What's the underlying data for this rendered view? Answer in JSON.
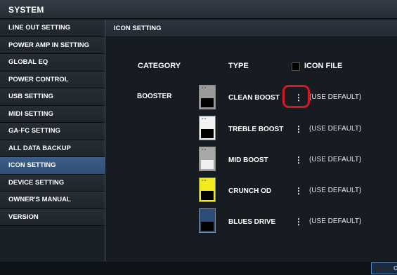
{
  "window": {
    "title": "SYSTEM"
  },
  "sidebar": {
    "items": [
      {
        "label": "LINE OUT SETTING",
        "active": false
      },
      {
        "label": "POWER AMP IN SETTING",
        "active": false
      },
      {
        "label": "GLOBAL EQ",
        "active": false
      },
      {
        "label": "POWER CONTROL",
        "active": false
      },
      {
        "label": "USB SETTING",
        "active": false
      },
      {
        "label": "MIDI SETTING",
        "active": false
      },
      {
        "label": "GA-FC SETTING",
        "active": false
      },
      {
        "label": "ALL DATA BACKUP",
        "active": false
      },
      {
        "label": "ICON SETTING",
        "active": true
      },
      {
        "label": "DEVICE SETTING",
        "active": false
      },
      {
        "label": "OWNER'S MANUAL",
        "active": false
      },
      {
        "label": "VERSION",
        "active": false
      }
    ]
  },
  "main": {
    "header": "ICON SETTING",
    "columns": {
      "category": "CATEGORY",
      "type": "TYPE",
      "icon_file": "ICON FILE"
    },
    "category": "BOOSTER",
    "rows": [
      {
        "type": "CLEAN BOOST",
        "menu": "⋮",
        "file": "(USE DEFAULT)",
        "pedal_color": "#9a9a9a",
        "foot_color": "#000000"
      },
      {
        "type": "TREBLE BOOST",
        "menu": "⋮",
        "file": "(USE DEFAULT)",
        "pedal_color": "#f2f2f2",
        "foot_color": "#000000"
      },
      {
        "type": "MID BOOST",
        "menu": "⋮",
        "file": "(USE DEFAULT)",
        "pedal_color": "#a8a8a8",
        "foot_color": "#f0f0f0"
      },
      {
        "type": "CRUNCH OD",
        "menu": "⋮",
        "file": "(USE DEFAULT)",
        "pedal_color": "#f3ea1e",
        "foot_color": "#000000"
      },
      {
        "type": "BLUES DRIVE",
        "menu": "⋮",
        "file": "(USE DEFAULT)",
        "pedal_color": "#2a4e78",
        "foot_color": "#000000"
      }
    ]
  },
  "footer": {
    "button_label": "C"
  },
  "colors": {
    "active_item": "#3c5e88",
    "highlight": "#d21822"
  }
}
